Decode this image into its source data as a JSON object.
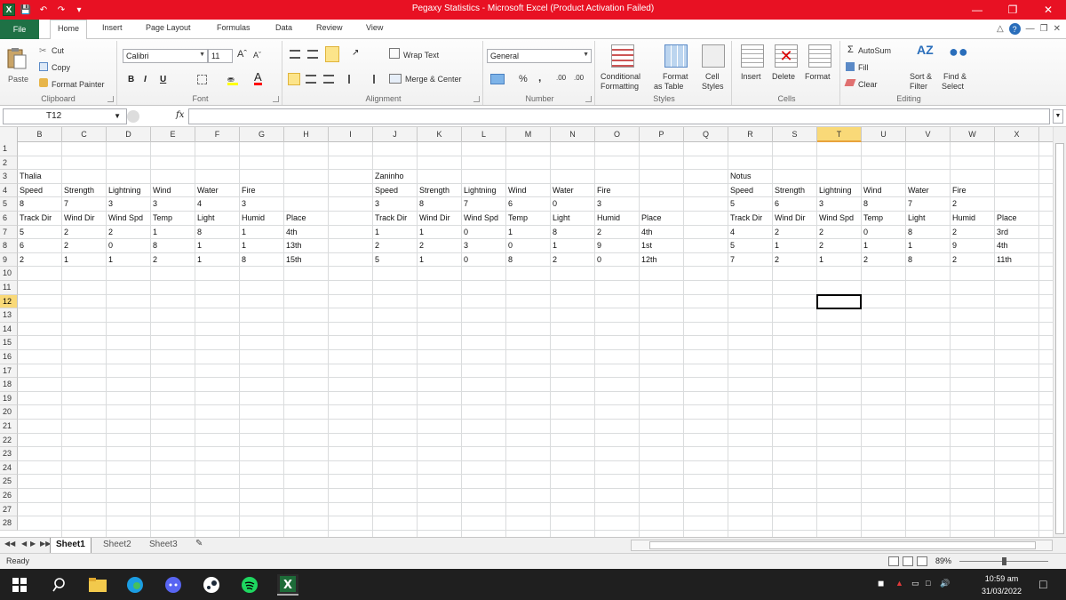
{
  "window": {
    "title": "Pegaxy Statistics  -  Microsoft Excel (Product Activation Failed)"
  },
  "colors": {
    "titlebar": "#e81123",
    "file_tab": "#1e7145",
    "selection_header": "#f9d978",
    "taskbar": "#1f1f1f"
  },
  "ribbon_tabs": [
    "File",
    "Home",
    "Insert",
    "Page Layout",
    "Formulas",
    "Data",
    "Review",
    "View"
  ],
  "ribbon": {
    "clipboard": {
      "paste": "Paste",
      "cut": "Cut",
      "copy": "Copy",
      "format_painter": "Format Painter",
      "label": "Clipboard"
    },
    "font": {
      "name": "Calibri",
      "size": "11",
      "bold": "B",
      "italic": "I",
      "underline": "U",
      "label": "Font"
    },
    "alignment": {
      "wrap_text": "Wrap Text",
      "merge_center": "Merge & Center",
      "label": "Alignment"
    },
    "number": {
      "format": "General",
      "percent": "%",
      "comma": ",",
      "inc_dec": ".00",
      "label": "Number"
    },
    "styles": {
      "conditional": "Conditional",
      "conditional2": "Formatting",
      "format_as": "Format",
      "format_as2": "as Table",
      "cell": "Cell",
      "cell2": "Styles",
      "label": "Styles"
    },
    "cells": {
      "insert": "Insert",
      "delete": "Delete",
      "format": "Format",
      "label": "Cells"
    },
    "editing": {
      "autosum": "AutoSum",
      "fill": "Fill",
      "clear": "Clear",
      "sort": "Sort &",
      "sort2": "Filter",
      "find": "Find &",
      "find2": "Select",
      "label": "Editing"
    }
  },
  "formula_bar": {
    "name_box": "T12",
    "fx": "fx",
    "value": ""
  },
  "columns": [
    "B",
    "C",
    "D",
    "E",
    "F",
    "G",
    "H",
    "I",
    "J",
    "K",
    "L",
    "M",
    "N",
    "O",
    "P",
    "Q",
    "R",
    "S",
    "T",
    "U",
    "V",
    "W",
    "X"
  ],
  "selected_column": "T",
  "rows": [
    "1",
    "2",
    "3",
    "4",
    "5",
    "6",
    "7",
    "8",
    "9",
    "10",
    "11",
    "12",
    "13",
    "14",
    "15",
    "16",
    "17",
    "18",
    "19",
    "20",
    "21",
    "22",
    "23",
    "24",
    "25",
    "26",
    "27",
    "28"
  ],
  "selected_row": "12",
  "cell_data": [
    {
      "r": 3,
      "c": "B",
      "v": "Thalia"
    },
    {
      "r": 3,
      "c": "J",
      "v": "Zaninho"
    },
    {
      "r": 3,
      "c": "R",
      "v": "Notus"
    },
    {
      "r": 4,
      "c": "B",
      "v": "Speed"
    },
    {
      "r": 4,
      "c": "C",
      "v": "Strength"
    },
    {
      "r": 4,
      "c": "D",
      "v": "Lightning"
    },
    {
      "r": 4,
      "c": "E",
      "v": "Wind"
    },
    {
      "r": 4,
      "c": "F",
      "v": "Water"
    },
    {
      "r": 4,
      "c": "G",
      "v": "Fire"
    },
    {
      "r": 4,
      "c": "J",
      "v": "Speed"
    },
    {
      "r": 4,
      "c": "K",
      "v": "Strength"
    },
    {
      "r": 4,
      "c": "L",
      "v": "Lightning"
    },
    {
      "r": 4,
      "c": "M",
      "v": "Wind"
    },
    {
      "r": 4,
      "c": "N",
      "v": "Water"
    },
    {
      "r": 4,
      "c": "O",
      "v": "Fire"
    },
    {
      "r": 4,
      "c": "R",
      "v": "Speed"
    },
    {
      "r": 4,
      "c": "S",
      "v": "Strength"
    },
    {
      "r": 4,
      "c": "T",
      "v": "Lightning"
    },
    {
      "r": 4,
      "c": "U",
      "v": "Wind"
    },
    {
      "r": 4,
      "c": "V",
      "v": "Water"
    },
    {
      "r": 4,
      "c": "W",
      "v": "Fire"
    },
    {
      "r": 5,
      "c": "B",
      "v": "8"
    },
    {
      "r": 5,
      "c": "C",
      "v": "7"
    },
    {
      "r": 5,
      "c": "D",
      "v": "3"
    },
    {
      "r": 5,
      "c": "E",
      "v": "3"
    },
    {
      "r": 5,
      "c": "F",
      "v": "4"
    },
    {
      "r": 5,
      "c": "G",
      "v": "3"
    },
    {
      "r": 5,
      "c": "J",
      "v": "3"
    },
    {
      "r": 5,
      "c": "K",
      "v": "8"
    },
    {
      "r": 5,
      "c": "L",
      "v": "7"
    },
    {
      "r": 5,
      "c": "M",
      "v": "6"
    },
    {
      "r": 5,
      "c": "N",
      "v": "0"
    },
    {
      "r": 5,
      "c": "O",
      "v": "3"
    },
    {
      "r": 5,
      "c": "R",
      "v": "5"
    },
    {
      "r": 5,
      "c": "S",
      "v": "6"
    },
    {
      "r": 5,
      "c": "T",
      "v": "3"
    },
    {
      "r": 5,
      "c": "U",
      "v": "8"
    },
    {
      "r": 5,
      "c": "V",
      "v": "7"
    },
    {
      "r": 5,
      "c": "W",
      "v": "2"
    },
    {
      "r": 6,
      "c": "B",
      "v": "Track Dir"
    },
    {
      "r": 6,
      "c": "C",
      "v": "Wind Dir"
    },
    {
      "r": 6,
      "c": "D",
      "v": "Wind Spd"
    },
    {
      "r": 6,
      "c": "E",
      "v": "Temp"
    },
    {
      "r": 6,
      "c": "F",
      "v": "Light"
    },
    {
      "r": 6,
      "c": "G",
      "v": "Humid"
    },
    {
      "r": 6,
      "c": "H",
      "v": "Place"
    },
    {
      "r": 6,
      "c": "J",
      "v": "Track Dir"
    },
    {
      "r": 6,
      "c": "K",
      "v": "Wind Dir"
    },
    {
      "r": 6,
      "c": "L",
      "v": "Wind Spd"
    },
    {
      "r": 6,
      "c": "M",
      "v": "Temp"
    },
    {
      "r": 6,
      "c": "N",
      "v": "Light"
    },
    {
      "r": 6,
      "c": "O",
      "v": "Humid"
    },
    {
      "r": 6,
      "c": "P",
      "v": "Place"
    },
    {
      "r": 6,
      "c": "R",
      "v": "Track Dir"
    },
    {
      "r": 6,
      "c": "S",
      "v": "Wind Dir"
    },
    {
      "r": 6,
      "c": "T",
      "v": "Wind Spd"
    },
    {
      "r": 6,
      "c": "U",
      "v": "Temp"
    },
    {
      "r": 6,
      "c": "V",
      "v": "Light"
    },
    {
      "r": 6,
      "c": "W",
      "v": "Humid"
    },
    {
      "r": 6,
      "c": "X",
      "v": "Place"
    },
    {
      "r": 7,
      "c": "B",
      "v": "5"
    },
    {
      "r": 7,
      "c": "C",
      "v": "2"
    },
    {
      "r": 7,
      "c": "D",
      "v": "2"
    },
    {
      "r": 7,
      "c": "E",
      "v": "1"
    },
    {
      "r": 7,
      "c": "F",
      "v": "8"
    },
    {
      "r": 7,
      "c": "G",
      "v": "1"
    },
    {
      "r": 7,
      "c": "H",
      "v": "4th"
    },
    {
      "r": 7,
      "c": "J",
      "v": "1"
    },
    {
      "r": 7,
      "c": "K",
      "v": "1"
    },
    {
      "r": 7,
      "c": "L",
      "v": "0"
    },
    {
      "r": 7,
      "c": "M",
      "v": "1"
    },
    {
      "r": 7,
      "c": "N",
      "v": "8"
    },
    {
      "r": 7,
      "c": "O",
      "v": "2"
    },
    {
      "r": 7,
      "c": "P",
      "v": "4th"
    },
    {
      "r": 7,
      "c": "R",
      "v": "4"
    },
    {
      "r": 7,
      "c": "S",
      "v": "2"
    },
    {
      "r": 7,
      "c": "T",
      "v": "2"
    },
    {
      "r": 7,
      "c": "U",
      "v": "0"
    },
    {
      "r": 7,
      "c": "V",
      "v": "8"
    },
    {
      "r": 7,
      "c": "W",
      "v": "2"
    },
    {
      "r": 7,
      "c": "X",
      "v": "3rd"
    },
    {
      "r": 8,
      "c": "B",
      "v": "6"
    },
    {
      "r": 8,
      "c": "C",
      "v": "2"
    },
    {
      "r": 8,
      "c": "D",
      "v": "0"
    },
    {
      "r": 8,
      "c": "E",
      "v": "8"
    },
    {
      "r": 8,
      "c": "F",
      "v": "1"
    },
    {
      "r": 8,
      "c": "G",
      "v": "1"
    },
    {
      "r": 8,
      "c": "H",
      "v": "13th"
    },
    {
      "r": 8,
      "c": "J",
      "v": "2"
    },
    {
      "r": 8,
      "c": "K",
      "v": "2"
    },
    {
      "r": 8,
      "c": "L",
      "v": "3"
    },
    {
      "r": 8,
      "c": "M",
      "v": "0"
    },
    {
      "r": 8,
      "c": "N",
      "v": "1"
    },
    {
      "r": 8,
      "c": "O",
      "v": "9"
    },
    {
      "r": 8,
      "c": "P",
      "v": "1st"
    },
    {
      "r": 8,
      "c": "R",
      "v": "5"
    },
    {
      "r": 8,
      "c": "S",
      "v": "1"
    },
    {
      "r": 8,
      "c": "T",
      "v": "2"
    },
    {
      "r": 8,
      "c": "U",
      "v": "1"
    },
    {
      "r": 8,
      "c": "V",
      "v": "1"
    },
    {
      "r": 8,
      "c": "W",
      "v": "9"
    },
    {
      "r": 8,
      "c": "X",
      "v": "4th"
    },
    {
      "r": 9,
      "c": "B",
      "v": "2"
    },
    {
      "r": 9,
      "c": "C",
      "v": "1"
    },
    {
      "r": 9,
      "c": "D",
      "v": "1"
    },
    {
      "r": 9,
      "c": "E",
      "v": "2"
    },
    {
      "r": 9,
      "c": "F",
      "v": "1"
    },
    {
      "r": 9,
      "c": "G",
      "v": "8"
    },
    {
      "r": 9,
      "c": "H",
      "v": "15th"
    },
    {
      "r": 9,
      "c": "J",
      "v": "5"
    },
    {
      "r": 9,
      "c": "K",
      "v": "1"
    },
    {
      "r": 9,
      "c": "L",
      "v": "0"
    },
    {
      "r": 9,
      "c": "M",
      "v": "8"
    },
    {
      "r": 9,
      "c": "N",
      "v": "2"
    },
    {
      "r": 9,
      "c": "O",
      "v": "0"
    },
    {
      "r": 9,
      "c": "P",
      "v": "12th"
    },
    {
      "r": 9,
      "c": "R",
      "v": "7"
    },
    {
      "r": 9,
      "c": "S",
      "v": "2"
    },
    {
      "r": 9,
      "c": "T",
      "v": "1"
    },
    {
      "r": 9,
      "c": "U",
      "v": "2"
    },
    {
      "r": 9,
      "c": "V",
      "v": "8"
    },
    {
      "r": 9,
      "c": "W",
      "v": "2"
    },
    {
      "r": 9,
      "c": "X",
      "v": "11th"
    }
  ],
  "sheets": [
    "Sheet1",
    "Sheet2",
    "Sheet3"
  ],
  "active_sheet": "Sheet1",
  "status": {
    "text": "Ready",
    "zoom": "89%"
  },
  "taskbar": {
    "time": "10:59 am",
    "date": "31/03/2022"
  }
}
